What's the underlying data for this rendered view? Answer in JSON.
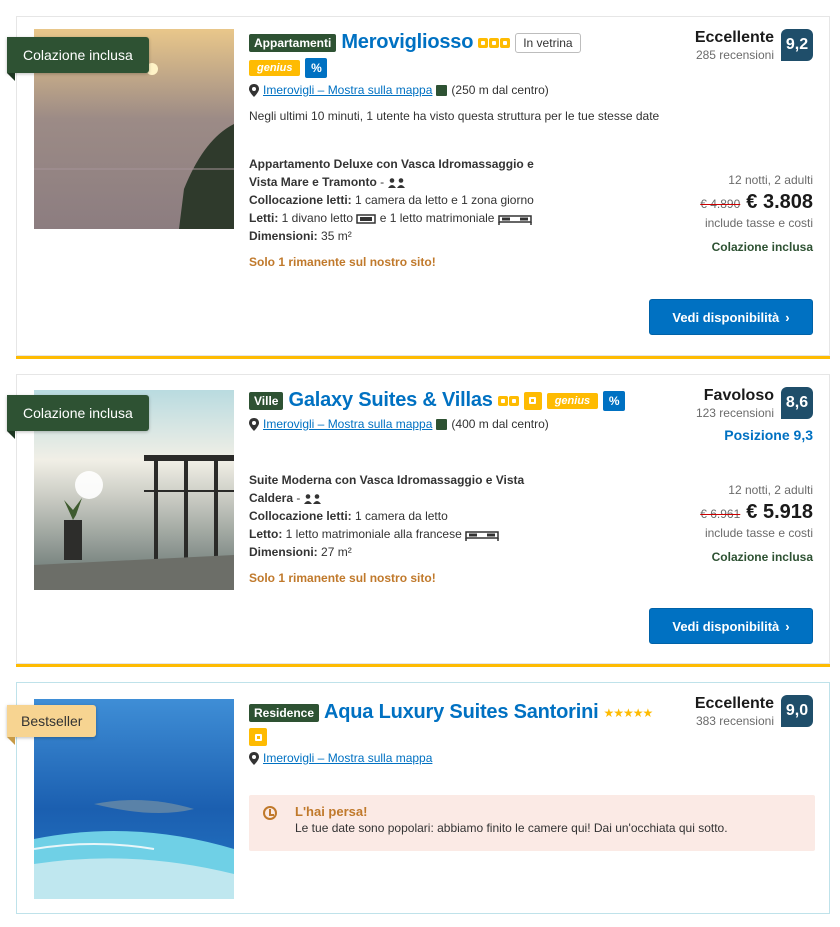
{
  "listings": [
    {
      "ribbon": "Colazione inclusa",
      "type": "Appartamenti",
      "name": "Merovigliosso",
      "featured": "In vetrina",
      "genius": "genius",
      "discount": "%",
      "location": "Imerovigli – Mostra sulla mappa",
      "distance": "(250 m dal centro)",
      "viewed": "Negli ultimi 10 minuti, 1 utente ha visto questa struttura per le tue stesse date",
      "room_name": "Appartamento Deluxe con Vasca Idromassaggio e Vista Mare e Tramonto",
      "room_sep": "-",
      "beds_label": "Collocazione letti:",
      "beds_value": "1 camera da letto e 1 zona giorno",
      "letti_label": "Letti:",
      "letti_value_a": "1 divano letto",
      "letti_value_b": "e 1 letto matrimoniale",
      "dim_label": "Dimensioni:",
      "dim_value": "35 m²",
      "scarcity": "Solo 1 rimanente sul nostro sito!",
      "rating_label": "Eccellente",
      "reviews": "285 recensioni",
      "score": "9,2",
      "nights": "12 notti, 2 adulti",
      "old_price": "€ 4.890",
      "price": "€ 3.808",
      "taxes": "include tasse e costi",
      "breakfast": "Colazione inclusa",
      "cta": "Vedi disponibilità",
      "chevron": "›"
    },
    {
      "ribbon": "Colazione inclusa",
      "type": "Ville",
      "name": "Galaxy Suites & Villas",
      "genius": "genius",
      "discount": "%",
      "location": "Imerovigli – Mostra sulla mappa",
      "distance": "(400 m dal centro)",
      "room_name": "Suite Moderna con Vasca Idromassaggio e Vista Caldera",
      "room_sep": "-",
      "beds_label": "Collocazione letti:",
      "beds_value": "1 camera da letto",
      "letti_label": "Letto:",
      "letti_value_a": "1 letto matrimoniale alla francese",
      "dim_label": "Dimensioni:",
      "dim_value": "27 m²",
      "scarcity": "Solo 1 rimanente sul nostro sito!",
      "rating_label": "Favoloso",
      "reviews": "123 recensioni",
      "score": "8,6",
      "position": "Posizione 9,3",
      "nights": "12 notti, 2 adulti",
      "old_price": "€ 6.961",
      "price": "€ 5.918",
      "taxes": "include tasse e costi",
      "breakfast": "Colazione inclusa",
      "cta": "Vedi disponibilità",
      "chevron": "›"
    },
    {
      "ribbon": "Bestseller",
      "type": "Residence",
      "name": "Aqua Luxury Suites Santorini",
      "stars": "★★★★★",
      "location": "Imerovigli – Mostra sulla mappa",
      "rating_label": "Eccellente",
      "reviews": "383 recensioni",
      "score": "9,0",
      "soldout_title": "L'hai persa!",
      "soldout_text": "Le tue date sono popolari: abbiamo finito le camere qui! Dai un'occhiata qui sotto."
    }
  ],
  "colors": {
    "brand_blue": "#0071c2",
    "green": "#2e5233",
    "yellow": "#febb02",
    "score_bg": "#1f4e6a",
    "scarcity": "#c0792b"
  }
}
